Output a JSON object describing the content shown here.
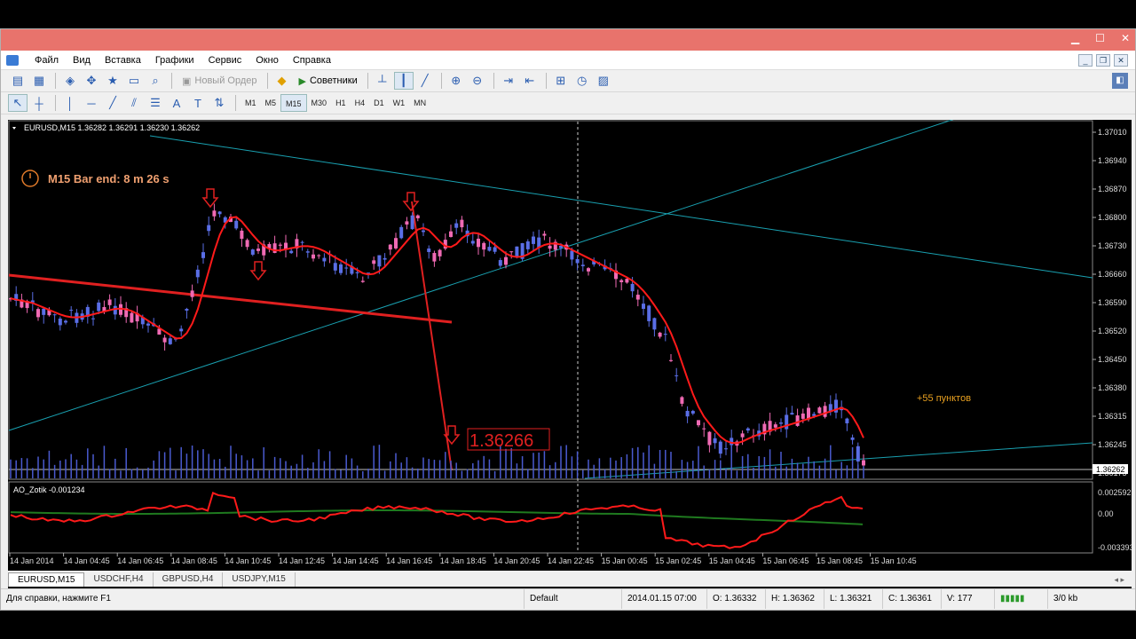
{
  "menu": [
    "Файл",
    "Вид",
    "Вставка",
    "Графики",
    "Сервис",
    "Окно",
    "Справка"
  ],
  "toolbar": {
    "new_order": "Новый Ордер",
    "experts": "Советники"
  },
  "timeframes": [
    "M1",
    "M5",
    "M15",
    "M30",
    "H1",
    "H4",
    "D1",
    "W1",
    "MN"
  ],
  "active_timeframe": "M15",
  "chart": {
    "header": "EURUSD,M15  1.36282 1.36291 1.36230 1.36262",
    "bar_timer": "M15 Bar end: 8 m 26 s",
    "profit_label": "+55 пунктов",
    "target_price": "1.36266",
    "current_price": "1.36262",
    "price_ticks": [
      "1.37010",
      "1.36940",
      "1.36870",
      "1.36800",
      "1.36730",
      "1.36660",
      "1.36590",
      "1.36520",
      "1.36450",
      "1.36380",
      "1.36315",
      "1.36245",
      "1.36175"
    ],
    "indicator_label": "AO_Zotik -0.001234",
    "indicator_ticks": [
      "0.002592",
      "0.00",
      "-0.003393"
    ],
    "time_labels": [
      "14 Jan 2014",
      "14 Jan 04:45",
      "14 Jan 06:45",
      "14 Jan 08:45",
      "14 Jan 10:45",
      "14 Jan 12:45",
      "14 Jan 14:45",
      "14 Jan 16:45",
      "14 Jan 18:45",
      "14 Jan 20:45",
      "14 Jan 22:45",
      "15 Jan 00:45",
      "15 Jan 02:45",
      "15 Jan 04:45",
      "15 Jan 06:45",
      "15 Jan 08:45",
      "15 Jan 10:45"
    ],
    "colors": {
      "bull": "#5a6ee6",
      "bear": "#f06ab4",
      "ma": "#ff1a1a",
      "trend": "#19a0b0",
      "signal": "#e02020",
      "ao_red": "#ff1a1a",
      "ao_green": "#1f7a1f"
    }
  },
  "tabs": [
    "EURUSD,M15",
    "USDCHF,H4",
    "GBPUSD,H4",
    "USDJPY,M15"
  ],
  "active_tab": "EURUSD,M15",
  "status": {
    "help": "Для справки, нажмите F1",
    "profile": "Default",
    "datetime": "2014.01.15 07:00",
    "open": "O: 1.36332",
    "high": "H: 1.36362",
    "low": "L: 1.36321",
    "close": "C: 1.36361",
    "volume": "V: 177",
    "traffic": "3/0 kb"
  }
}
